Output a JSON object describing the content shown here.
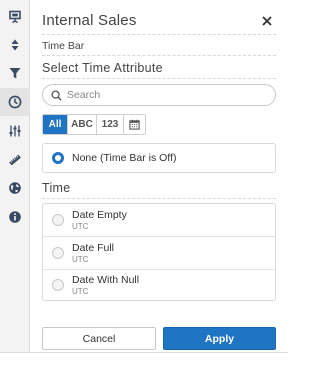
{
  "dialog": {
    "title": "Internal Sales",
    "subtitle": "Time Bar",
    "section_heading": "Select Time Attribute",
    "search_placeholder": "Search"
  },
  "filters": [
    {
      "label": "All",
      "active": true
    },
    {
      "label": "ABC",
      "active": false
    },
    {
      "label": "123",
      "active": false
    },
    {
      "label": "calendar-icon",
      "active": false
    }
  ],
  "none_option": {
    "label": "None (Time Bar is Off)",
    "selected": true
  },
  "time_section": {
    "heading": "Time",
    "items": [
      {
        "label": "Date Empty",
        "sub": "UTC",
        "selected": false
      },
      {
        "label": "Date Full",
        "sub": "UTC",
        "selected": false
      },
      {
        "label": "Date With Null",
        "sub": "UTC",
        "selected": false
      }
    ]
  },
  "buttons": {
    "cancel": "Cancel",
    "apply": "Apply"
  },
  "sidebar": [
    {
      "icon": "presentation-icon",
      "active": false
    },
    {
      "icon": "sort-icon",
      "active": false
    },
    {
      "icon": "filter-icon",
      "active": false
    },
    {
      "icon": "clock-icon",
      "active": true
    },
    {
      "icon": "sliders-icon",
      "active": false
    },
    {
      "icon": "ruler-icon",
      "active": false
    },
    {
      "icon": "globe-icon",
      "active": false
    },
    {
      "icon": "info-icon",
      "active": false
    }
  ],
  "colors": {
    "accent": "#1f74c4",
    "icon": "#3b4a63"
  }
}
